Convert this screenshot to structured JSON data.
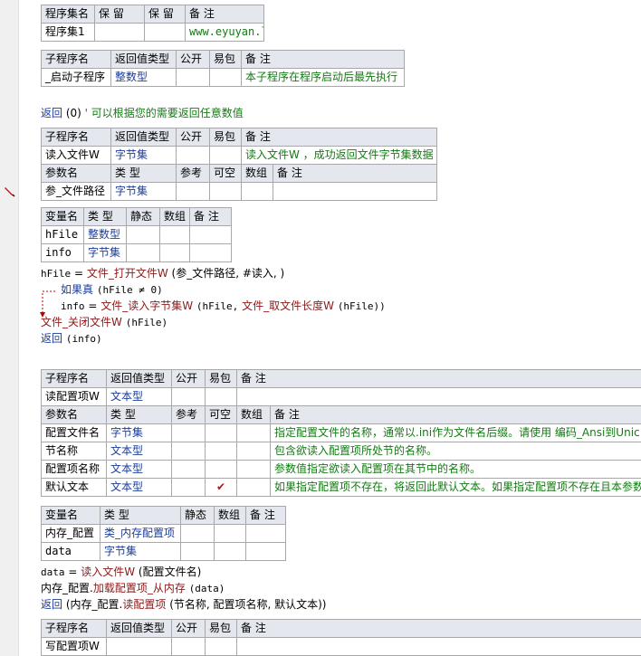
{
  "hdr": {
    "set_name": "程序集名",
    "reserve": "保 留",
    "note": "备 注",
    "sub_name": "子程序名",
    "ret_type": "返回值类型",
    "public": "公开",
    "easy_pkg": "易包",
    "param_name": "参数名",
    "type": "类 型",
    "ref": "参考",
    "nullable": "可空",
    "array": "数组",
    "var_name": "变量名",
    "static": "静态"
  },
  "assembly": {
    "name": "程序集1",
    "note": "www.eyuyan.la"
  },
  "startup_sub": {
    "name": "_启动子程序",
    "ret_type": "整数型",
    "note": "本子程序在程序启动后最先执行"
  },
  "startup_code": {
    "ret_keyword": "返回",
    "ret_value": "(0)",
    "comment": "' 可以根据您的需要返回任意数值"
  },
  "readfile_sub": {
    "name": "读入文件W",
    "ret_type": "字节集",
    "note": "读入文件W ，成功返回文件字节集数据",
    "params": [
      {
        "name": "参_文件路径",
        "type": "字节集"
      }
    ],
    "vars": [
      {
        "name": "hFile",
        "type": "整数型"
      },
      {
        "name": "info",
        "type": "字节集"
      }
    ],
    "code": {
      "l1_var": "hFile",
      "l1_eq": "=",
      "l1_fn": "文件_打开文件W",
      "l1_args": "(参_文件路径, #读入, )",
      "l2_kw": "如果真",
      "l2_cond": "(hFile ≠ 0)",
      "l3_var": "info",
      "l3_eq": "=",
      "l3_fn": "文件_读入字节集W",
      "l3_a": "(hFile,",
      "l3_fn2": "文件_取文件长度W",
      "l3_b": "(hFile))",
      "l4_fn": "文件_关闭文件W",
      "l4_args": "(hFile)",
      "l5_kw": "返回",
      "l5_args": "(info)"
    }
  },
  "readcfg_sub": {
    "name": "读配置项W",
    "ret_type": "文本型",
    "params": [
      {
        "name": "配置文件名",
        "type": "字节集",
        "nullable": "",
        "note": "指定配置文件的名称，通常以.ini作为文件名后缀。请使用 编码_Ansi到Unic"
      },
      {
        "name": "节名称",
        "type": "文本型",
        "nullable": "",
        "note": "包含欲读入配置项所处节的名称。"
      },
      {
        "name": "配置项名称",
        "type": "文本型",
        "nullable": "",
        "note": "参数值指定欲读入配置项在其节中的名称。"
      },
      {
        "name": "默认文本",
        "type": "文本型",
        "nullable": "✔",
        "note": "如果指定配置项不存在，将返回此默认文本。如果指定配置项不存在且本参数"
      }
    ],
    "vars": [
      {
        "name": "内存_配置",
        "type": "类_内存配置项"
      },
      {
        "name": "data",
        "type": "字节集"
      }
    ],
    "code": {
      "l1_var": "data",
      "l1_eq": "=",
      "l1_fn": "读入文件W",
      "l1_args": "(配置文件名)",
      "l2_obj": "内存_配置",
      "l2_method": "加载配置项_从内存",
      "l2_args": "(data)",
      "l3_kw": "返回",
      "l3_open": "(内存_配置.",
      "l3_method": "读配置项",
      "l3_args": "(节名称, 配置项名称, 默认文本))"
    }
  },
  "writecfg_sub": {
    "name": "写配置项W"
  },
  "colors": {
    "header_bg": "#e4e8ee",
    "border": "#a8a8a8",
    "type_blue": "#1c3d9a",
    "note_green": "#137a13",
    "func_red": "#8b1a1a",
    "flow_red": "#c00000"
  },
  "icons": {
    "gutter_marker": "pencil-icon",
    "check": "check-icon"
  }
}
